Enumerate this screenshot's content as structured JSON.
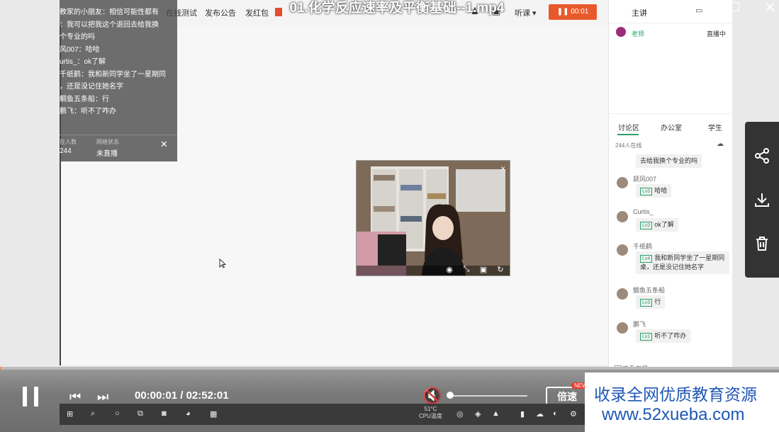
{
  "video": {
    "title": "01.化学反应速率及平衡基础--1.mp4"
  },
  "topbar": {
    "partial_text": "在线测试",
    "notice": "发布公告",
    "red_packet": "发红包",
    "listen": "听课 ▾",
    "record_time": "00:01"
  },
  "chat_overlay": {
    "lines": [
      "教家的小朋友：相信可能性都有",
      "：我可以把我这个退回去给我换",
      "个专业的吗",
      "风007：哈哈",
      "urtis_：ok了解",
      "千纸鹤：我和新同学坐了一星期同",
      "，还是没记住她名字",
      "鲷鱼五条船：行",
      "鹏飞：听不了咋办"
    ],
    "stats": {
      "online_label": "在人数",
      "online_value": "244",
      "status_label": "网络状态",
      "status_value": "未直播"
    }
  },
  "rpanel": {
    "tab_main": "主讲",
    "teacher_name": "老师",
    "teacher_status": "直播中",
    "tabs": [
      "讨论区",
      "办公室",
      "学生"
    ],
    "online_count": "244人在线",
    "messages": [
      {
        "name": "",
        "level": "",
        "text": "去给我换个专业的吗"
      },
      {
        "name": "颉风007",
        "level": "Lv3",
        "text": "哈哈"
      },
      {
        "name": "Curtis_",
        "level": "Lv3",
        "text": "ok了解"
      },
      {
        "name": "千纸鹤",
        "level": "Lv4",
        "text": "我和新同学坐了一星期同桌，还是没记住她名字"
      },
      {
        "name": "鲷鱼五条船",
        "level": "Lv3",
        "text": "行"
      },
      {
        "name": "鹏飞",
        "level": "Lv1",
        "text": "听不了咋办"
      }
    ],
    "only_teacher": "只看老师"
  },
  "player": {
    "current_time": "00:00:01",
    "total_time": "02:52:01",
    "time_sep": " / ",
    "speed_label": "倍速",
    "new_badge": "NEW",
    "progress": 0.001,
    "volume": 0
  },
  "taskbar": {
    "cpu_temp": "51°C",
    "cpu_label": "CPU温度"
  },
  "watermark": {
    "line1": "收录全网优质教育资源",
    "line2": "www.52xueba.com"
  },
  "colors": {
    "accent": "#ff6b2a",
    "record": "#e85a2c",
    "watermark": "#1f57b5"
  }
}
